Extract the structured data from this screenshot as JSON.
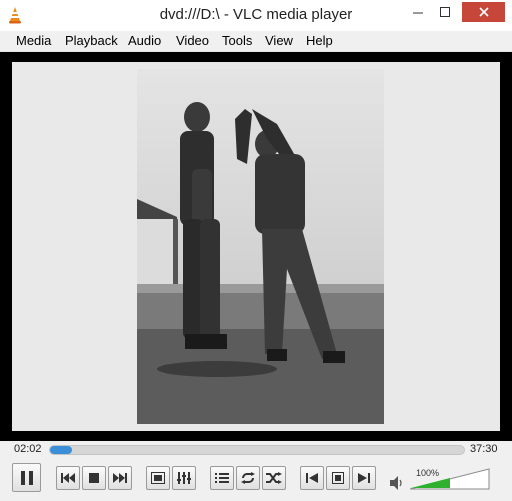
{
  "window": {
    "title": "dvd:///D:\\ - VLC media player"
  },
  "menu": [
    "Media",
    "Playback",
    "Audio",
    "Video",
    "Tools",
    "View",
    "Help"
  ],
  "seek": {
    "elapsed": "02:02",
    "total": "37:30",
    "progress": 0.054
  },
  "volume": {
    "label": "100%",
    "level": 1.0
  },
  "controls": {
    "icons": [
      "pause-icon",
      "previous-chapter-icon",
      "stop-icon",
      "next-chapter-icon",
      "fullscreen-icon",
      "extended-settings-icon",
      "playlist-icon",
      "loop-icon",
      "shuffle-icon",
      "frame-back-icon",
      "record-icon",
      "frame-forward-icon",
      "speaker-icon"
    ]
  },
  "colors": {
    "accent": "#3b8fd9",
    "volume_green": "#2fb12f",
    "close_button": "#c7463a"
  }
}
